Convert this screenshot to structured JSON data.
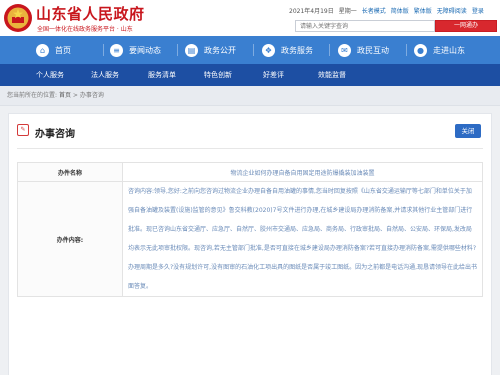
{
  "header": {
    "site_title": "山东省人民政府",
    "site_subtitle": "全国一体化在线政务服务平台 · 山东",
    "date": "2021年4月19日",
    "weekday": "星期一",
    "links": [
      "长者模式",
      "简体版",
      "繁体版",
      "无障碍阅读",
      "登录"
    ],
    "search_placeholder": "请输入关键字查询",
    "search_button": "一网通办"
  },
  "nav": {
    "items": [
      {
        "label": "首页",
        "icon": "home-icon"
      },
      {
        "label": "要闻动态",
        "icon": "news-icon"
      },
      {
        "label": "政务公开",
        "icon": "document-icon"
      },
      {
        "label": "政务服务",
        "icon": "service-icon"
      },
      {
        "label": "政民互动",
        "icon": "chat-icon"
      },
      {
        "label": "走进山东",
        "icon": "location-icon"
      }
    ]
  },
  "subnav": {
    "items": [
      "个人服务",
      "法人服务",
      "服务清单",
      "特色创新",
      "好差评",
      "效能监督"
    ]
  },
  "breadcrumb": {
    "prefix": "您当前所在的位置:",
    "items": [
      "首页",
      "办事咨询"
    ],
    "separator": ">"
  },
  "card": {
    "title": "办事咨询",
    "close_label": "关闭",
    "subject_label": "办件名称",
    "subject_value": "物流企业如何办理自备自用固定用途防爆撬装加油装置",
    "content_label": "办件内容:",
    "content_value": "咨询内容:领导,您好:之前向您咨询过物流企业办理自备自用油罐的事情,您当时回复按照《山东省交通运输厅等七部门和单位关于加强自备油罐及装置(设施)监管的意见》鲁交科教(2020)7号文件进行办理,在城乡建设局办理消防备案,并请求其他行业主管部门进行批准。现已咨询山东省交通厅、应急厅、自然厅、胶州市交通局、应急局、商务局、行政审批局、自然局、公安局、环保局,发改局均表示无此项审批权限。现咨询,若无主管部门批准,是否可直接在城乡建设局办理消防备案?若可直接办理消防备案,需提供哪些材料?办理周期是多久?没有规划许可,没有图审的石油化工项出具的图纸是否属于竣工图纸。因为之前都是电话沟通,现恳请领导在此给出书面答复。"
  },
  "colors": {
    "brand_red": "#c8161d",
    "nav_blue": "#3a7fd0",
    "subnav_blue": "#1d4fa3",
    "button_blue": "#2d6bc4",
    "search_red": "#d8282e"
  }
}
